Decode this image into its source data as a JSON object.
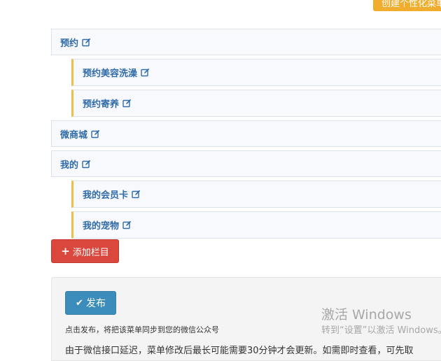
{
  "toolbar": {
    "create_menu_label": "创建个性化菜单"
  },
  "menu": {
    "items": [
      {
        "label": "预约",
        "level": "top"
      },
      {
        "label": "预约美容洗澡",
        "level": "sub"
      },
      {
        "label": "预约寄养",
        "level": "sub"
      },
      {
        "label": "微商城",
        "level": "top"
      },
      {
        "label": "我的",
        "level": "top"
      },
      {
        "label": "我的会员卡",
        "level": "sub"
      },
      {
        "label": "我的宠物",
        "level": "sub"
      }
    ],
    "add_label": "添加栏目"
  },
  "publish": {
    "button_label": "发布",
    "hint": "点击发布，将把该菜单同步到您的微信公众号",
    "note": "由于微信接口延迟，菜单修改后最长可能需要30分钟才会更新。如需即时查看，可先取"
  },
  "watermark": {
    "title": "激活 Windows",
    "subtitle": "转到“设置”以激活 Windows。"
  },
  "colors": {
    "accent_blue": "#3c8dbc",
    "add_red": "#d9473d",
    "top_orange": "#f0ad2e",
    "sub_border": "#e8c04a",
    "label_blue": "#2f6ba8"
  }
}
